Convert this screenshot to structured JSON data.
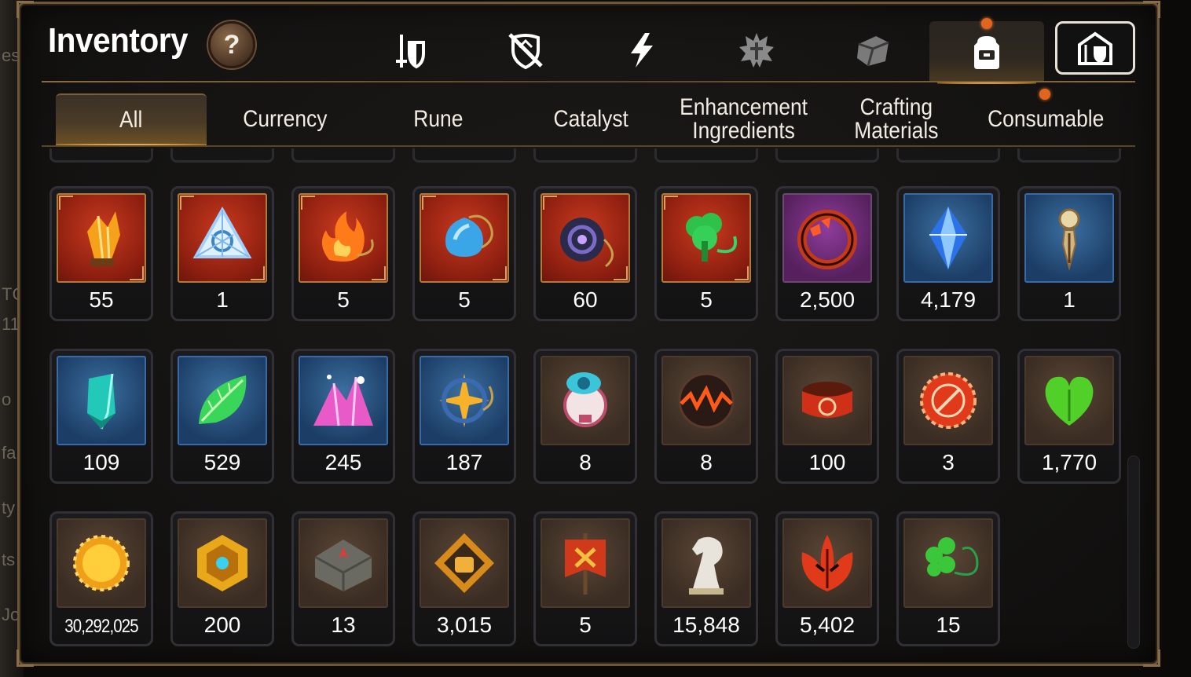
{
  "background": {
    "left_fragments": [
      "es",
      "TC",
      "11",
      "o",
      "fa",
      "ty",
      "ts",
      "Jo"
    ]
  },
  "header": {
    "title": "Inventory",
    "help_label": "?"
  },
  "category_icons": [
    {
      "name": "equipment-icon",
      "active": false
    },
    {
      "name": "no-shield-icon",
      "active": false
    },
    {
      "name": "lightning-icon",
      "active": false
    },
    {
      "name": "spiky-crest-icon",
      "active": false
    },
    {
      "name": "stone-block-icon",
      "active": false
    },
    {
      "name": "backpack-icon",
      "active": true,
      "notification": true
    },
    {
      "name": "armory-icon",
      "active": false
    }
  ],
  "tabs": [
    {
      "label": "All",
      "active": true
    },
    {
      "label": "Currency",
      "active": false
    },
    {
      "label": "Rune",
      "active": false
    },
    {
      "label": "Catalyst",
      "active": false
    },
    {
      "label": "Enhancement Ingredients",
      "active": false
    },
    {
      "label": "Crafting Materials",
      "active": false
    },
    {
      "label": "Consumable",
      "active": false,
      "notification": true
    }
  ],
  "items": [
    [
      {
        "icon": "orange-crystal-rune-icon",
        "frame": "red",
        "qty": "55"
      },
      {
        "icon": "triangle-crystal-rune-icon",
        "frame": "red",
        "qty": "1"
      },
      {
        "icon": "fire-charm-icon",
        "frame": "red",
        "qty": "5"
      },
      {
        "icon": "water-charm-icon",
        "frame": "red",
        "qty": "5"
      },
      {
        "icon": "dark-ring-charm-icon",
        "frame": "red",
        "qty": "60"
      },
      {
        "icon": "tree-charm-icon",
        "frame": "red",
        "qty": "5"
      },
      {
        "icon": "flame-ring-icon",
        "frame": "purple",
        "qty": "2,500"
      },
      {
        "icon": "blue-gem-icon",
        "frame": "blue",
        "qty": "4,179"
      },
      {
        "icon": "dagger-pendant-icon",
        "frame": "blue",
        "qty": "1"
      }
    ],
    [
      {
        "icon": "teal-crystal-icon",
        "frame": "blue",
        "qty": "109"
      },
      {
        "icon": "green-leaf-icon",
        "frame": "blue",
        "qty": "529"
      },
      {
        "icon": "pink-crystal-pile-icon",
        "frame": "blue",
        "qty": "245"
      },
      {
        "icon": "star-charm-icon",
        "frame": "blue",
        "qty": "187"
      },
      {
        "icon": "mech-pod-icon",
        "frame": "brown",
        "qty": "8"
      },
      {
        "icon": "lava-orb-icon",
        "frame": "brown",
        "qty": "8"
      },
      {
        "icon": "red-band-icon",
        "frame": "brown",
        "qty": "100"
      },
      {
        "icon": "red-seal-icon",
        "frame": "brown",
        "qty": "3"
      },
      {
        "icon": "green-heart-icon",
        "frame": "brown",
        "qty": "1,770"
      }
    ],
    [
      {
        "icon": "gold-coin-icon",
        "frame": "brown",
        "qty": "30,292,025"
      },
      {
        "icon": "gold-emblem-icon",
        "frame": "brown",
        "qty": "200"
      },
      {
        "icon": "stone-compass-icon",
        "frame": "brown",
        "qty": "13"
      },
      {
        "icon": "fist-badge-icon",
        "frame": "brown",
        "qty": "3,015"
      },
      {
        "icon": "war-banner-icon",
        "frame": "brown",
        "qty": "5"
      },
      {
        "icon": "white-knight-icon",
        "frame": "brown",
        "qty": "15,848"
      },
      {
        "icon": "red-leaf-icon",
        "frame": "brown",
        "qty": "5,402"
      },
      {
        "icon": "clover-charm-icon",
        "frame": "brown",
        "qty": "15"
      }
    ]
  ]
}
